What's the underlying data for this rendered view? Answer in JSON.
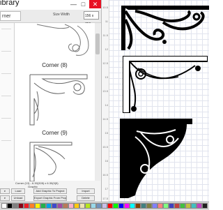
{
  "window": {
    "title": "ibrary",
    "min": "—",
    "max": "□",
    "close": "✕"
  },
  "toolbar": {
    "tab_label": "rner",
    "size_label": "Size Width",
    "size_value": "156 x 750"
  },
  "gallery": {
    "items": [
      {
        "name": "Corner (8)"
      },
      {
        "name": "Corner (9)"
      }
    ]
  },
  "footer": {
    "corner_info": "Corner (13) - 6.30(328) x 6.30(9(5)",
    "graphic_label": "Graphic",
    "buttons": {
      "left1": "e",
      "load": "Load",
      "add": "Add Graphic To Project",
      "import": "Import",
      "left2": "e",
      "unload": "Unload",
      "export": "Export Graphic From Project",
      "delete": "Delete"
    }
  },
  "ruler": {
    "ticks": [
      "10.5",
      "11",
      "11.5",
      "12",
      "12.5",
      "13",
      "13.5",
      "14",
      "14.5",
      "15",
      "15.5",
      "16",
      "16.5",
      "17",
      "17.5"
    ]
  },
  "palette": {
    "colors": [
      "#ffffff",
      "#000000",
      "#7f7f7f",
      "#880015",
      "#ed1c24",
      "#ff7f27",
      "#fff200",
      "#22b14c",
      "#00a2e8",
      "#3f48cc",
      "#a349a4",
      "#b97a57",
      "#ffaec9",
      "#ffc90e",
      "#efe4b0",
      "#b5e61d",
      "#99d9ea",
      "#7092be",
      "#c8bfe7",
      "#ff0000",
      "#00ff00",
      "#0000ff",
      "#ff00ff",
      "#00ffff",
      "#804000",
      "#408080",
      "#808040",
      "#8080ff",
      "#ff8080",
      "#80ff80",
      "#4040c0",
      "#c04040",
      "#40c040",
      "#c0c040",
      "#40c0c0",
      "#c040c0",
      "#202020"
    ]
  }
}
